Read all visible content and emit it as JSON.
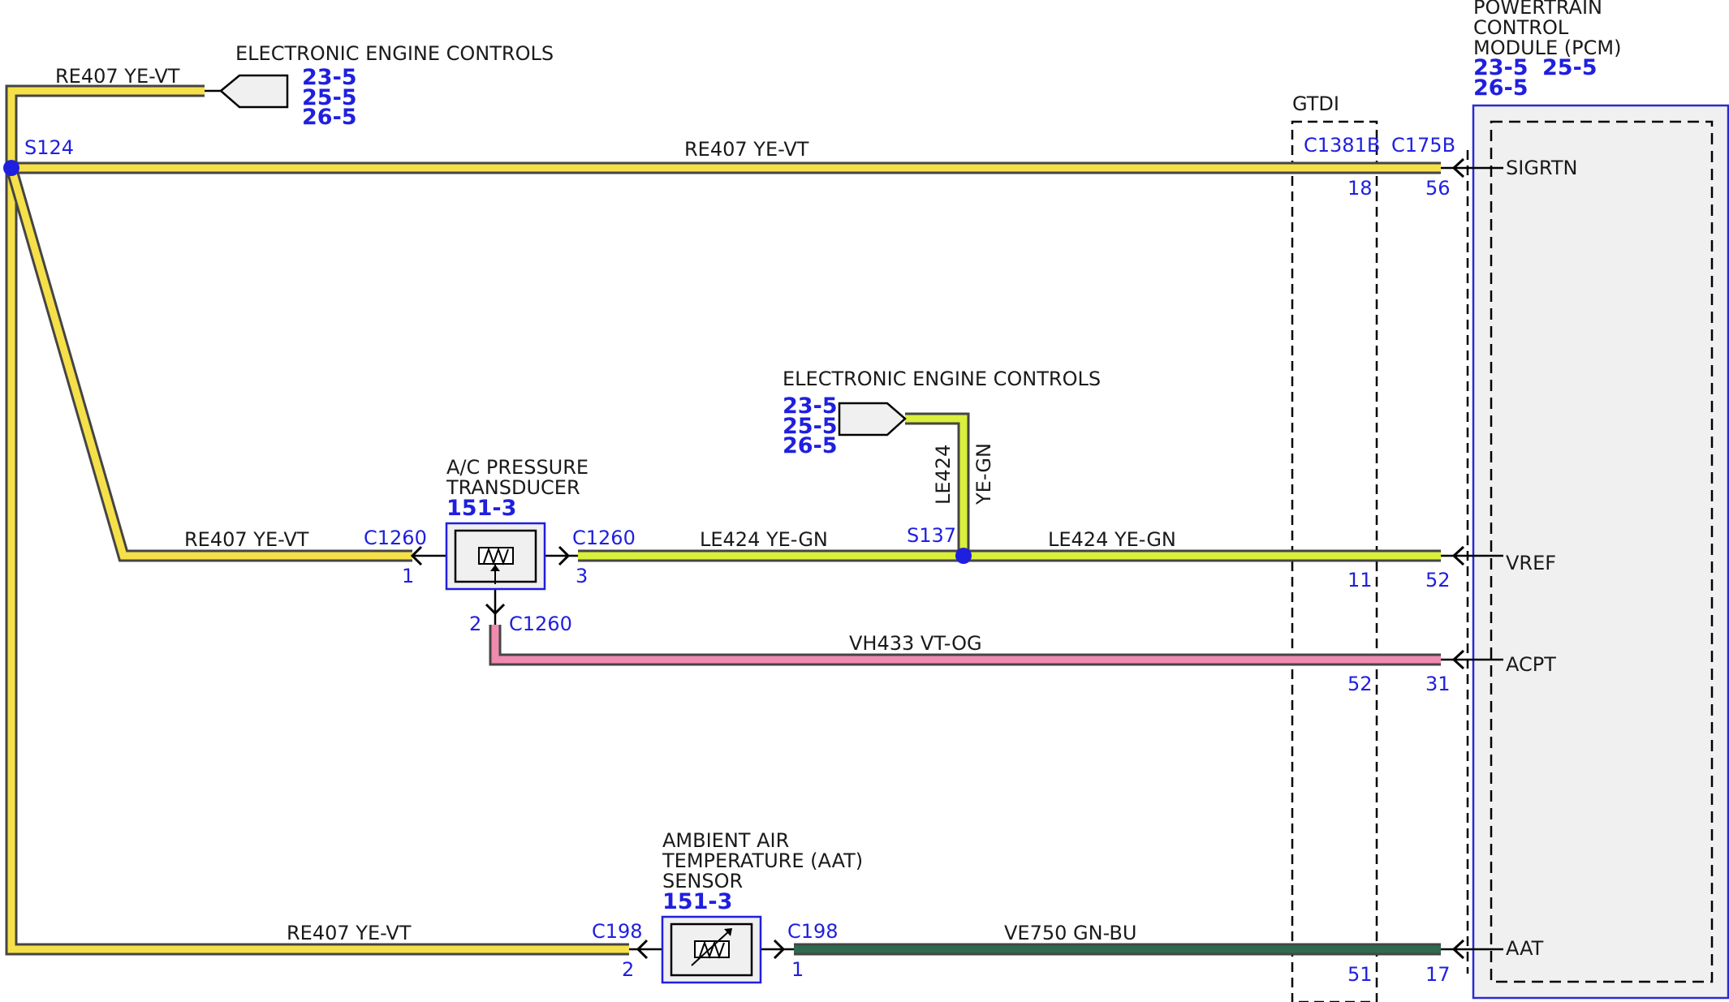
{
  "pcm": {
    "title_lines": [
      "POWERTRAIN",
      "CONTROL",
      "MODULE (PCM)"
    ],
    "refs": [
      "23-5",
      "25-5",
      "26-5"
    ],
    "pins": [
      "SIGRTN",
      "VREF",
      "ACPT",
      "AAT"
    ]
  },
  "gtdi": {
    "label": "GTDI"
  },
  "connectors": {
    "c1381b": "C1381B",
    "c175b": "C175B",
    "c1260": "C1260",
    "c198": "C198"
  },
  "splices": {
    "s124": "S124",
    "s137": "S137"
  },
  "eec": {
    "label": "ELECTRONIC ENGINE CONTROLS",
    "refs": [
      "23-5",
      "25-5",
      "26-5"
    ]
  },
  "ac_transducer": {
    "lines": [
      "A/C PRESSURE",
      "TRANSDUCER"
    ],
    "ref": "151-3"
  },
  "aat_sensor": {
    "lines": [
      "AMBIENT AIR",
      "TEMPERATURE (AAT)",
      "SENSOR"
    ],
    "ref": "151-3"
  },
  "circuits": {
    "re407": "RE407  YE-VT",
    "le424": "LE424  YE-GN",
    "le424_circuit": "LE424",
    "le424_color": "YE-GN",
    "vh433": "VH433  VT-OG",
    "ve750": "VE750  GN-BU"
  },
  "pin_numbers": {
    "sigrtn_c1381b": "18",
    "sigrtn_c175b": "56",
    "vref_c1381b": "11",
    "vref_c175b": "52",
    "acpt_c1381b": "52",
    "acpt_c175b": "31",
    "aat_c1381b": "51",
    "aat_c175b": "17",
    "c1260_pin1": "1",
    "c1260_pin3": "3",
    "c1260_pin2": "2",
    "c198_pin2": "2",
    "c198_pin1": "1"
  },
  "colors": {
    "ye_vt": "#F5E04A",
    "ye_gn": "#D9F03C",
    "vt_og": "#F08AAE",
    "gn_bu": "#2E6B4E",
    "text_blue": "#1F1FE0",
    "box_fill": "#F0F0F0"
  }
}
